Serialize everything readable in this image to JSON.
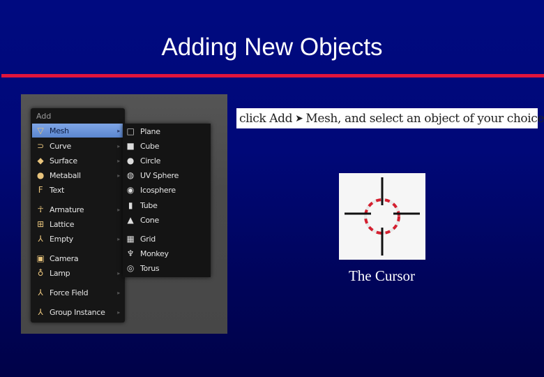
{
  "slide": {
    "title": "Adding New Objects",
    "accent_color": "#e0143c",
    "background_color": "#000a80"
  },
  "menu": {
    "header": "Add",
    "items": [
      {
        "label": "Mesh",
        "icon": "mesh-icon",
        "glyph": "▽",
        "active": true,
        "has_submenu": true
      },
      {
        "label": "Curve",
        "icon": "curve-icon",
        "glyph": "⊃",
        "has_submenu": true
      },
      {
        "label": "Surface",
        "icon": "surface-icon",
        "glyph": "◆",
        "has_submenu": true
      },
      {
        "label": "Metaball",
        "icon": "metaball-icon",
        "glyph": "●",
        "has_submenu": true
      },
      {
        "label": "Text",
        "icon": "text-icon",
        "glyph": "F",
        "has_submenu": false
      },
      {
        "label": "Armature",
        "icon": "armature-icon",
        "glyph": "☥",
        "has_submenu": true
      },
      {
        "label": "Lattice",
        "icon": "lattice-icon",
        "glyph": "⊞",
        "has_submenu": false
      },
      {
        "label": "Empty",
        "icon": "empty-icon",
        "glyph": "⅄",
        "has_submenu": true
      },
      {
        "label": "Camera",
        "icon": "camera-icon",
        "glyph": "▣",
        "has_submenu": false
      },
      {
        "label": "Lamp",
        "icon": "lamp-icon",
        "glyph": "♁",
        "has_submenu": true
      },
      {
        "label": "Force Field",
        "icon": "force-field-icon",
        "glyph": "⅄",
        "has_submenu": true
      },
      {
        "label": "Group Instance",
        "icon": "group-instance-icon",
        "glyph": "⅄",
        "has_submenu": true
      }
    ]
  },
  "submenu": {
    "items": [
      {
        "label": "Plane",
        "icon": "plane-icon",
        "glyph": "□"
      },
      {
        "label": "Cube",
        "icon": "cube-icon",
        "glyph": "■"
      },
      {
        "label": "Circle",
        "icon": "circle-icon",
        "glyph": "●"
      },
      {
        "label": "UV Sphere",
        "icon": "uv-sphere-icon",
        "glyph": "◍"
      },
      {
        "label": "Icosphere",
        "icon": "icosphere-icon",
        "glyph": "◉"
      },
      {
        "label": "Tube",
        "icon": "tube-icon",
        "glyph": "▮"
      },
      {
        "label": "Cone",
        "icon": "cone-icon",
        "glyph": "▲"
      },
      {
        "label": "Grid",
        "icon": "grid-icon",
        "glyph": "▦"
      },
      {
        "label": "Monkey",
        "icon": "monkey-icon",
        "glyph": "♆"
      },
      {
        "label": "Torus",
        "icon": "torus-icon",
        "glyph": "◎"
      }
    ]
  },
  "instruction": {
    "part1": "click Add",
    "arrow": "➤",
    "part2": "Mesh, and select an object of your choice."
  },
  "cursor_figure": {
    "caption": "The Cursor",
    "ring_color": "#d42030",
    "cross_color": "#111111"
  }
}
